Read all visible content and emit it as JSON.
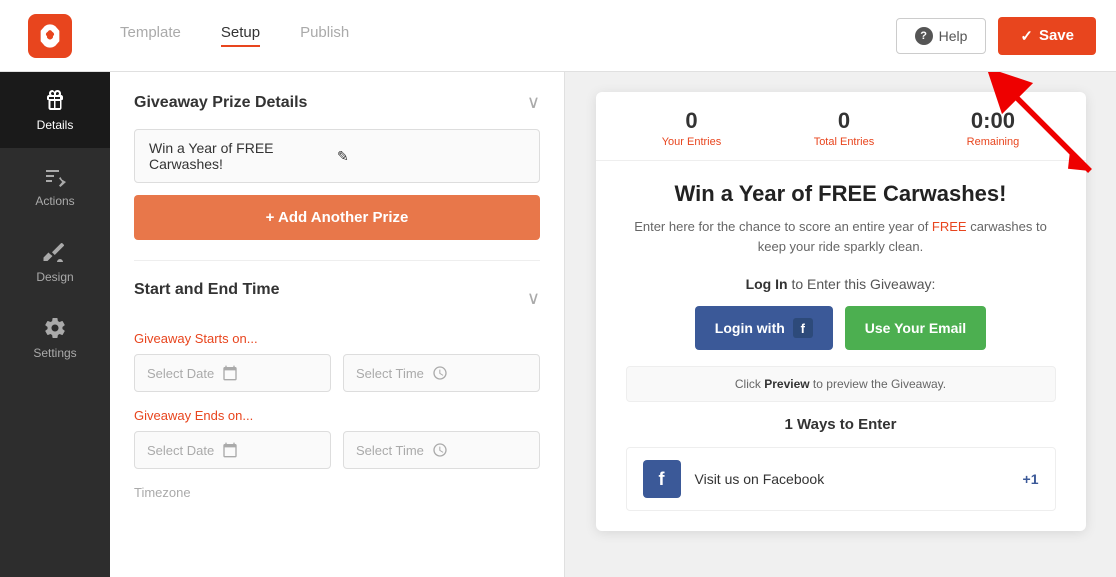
{
  "topNav": {
    "tabs": [
      {
        "id": "template",
        "label": "Template",
        "active": false
      },
      {
        "id": "setup",
        "label": "Setup",
        "active": true
      },
      {
        "id": "publish",
        "label": "Publish",
        "active": false
      }
    ],
    "helpLabel": "Help",
    "saveLabel": "Save"
  },
  "sidebar": {
    "items": [
      {
        "id": "details",
        "label": "Details",
        "active": true,
        "icon": "gift"
      },
      {
        "id": "actions",
        "label": "Actions",
        "active": false,
        "icon": "actions"
      },
      {
        "id": "design",
        "label": "Design",
        "active": false,
        "icon": "design"
      },
      {
        "id": "settings",
        "label": "Settings",
        "active": false,
        "icon": "settings"
      }
    ]
  },
  "leftPanel": {
    "prizeSectionTitle": "Giveaway Prize Details",
    "prizeValue": "Win a Year of FREE Carwashes!",
    "addPrizeLabel": "+ Add Another Prize",
    "dateSectionTitle": "Start and End Time",
    "startLabel": "Giveaway Starts on...",
    "startDatePlaceholder": "Select Date",
    "startTimePlaceholder": "Select Time",
    "endLabel": "Giveaway Ends on...",
    "endDatePlaceholder": "Select Date",
    "endTimePlaceholder": "Select Time",
    "timezoneLabel": "Timezone"
  },
  "preview": {
    "stats": [
      {
        "value": "0",
        "label": "Your Entries"
      },
      {
        "value": "0",
        "label": "Total Entries"
      },
      {
        "value": "0:00",
        "label": "Remaining"
      }
    ],
    "title": "Win a Year of FREE Carwashes!",
    "description": "Enter here for the chance to score an entire year of FREE carwashes to keep your ride sparkly clean.",
    "loginPrompt": "Log In to Enter this Giveaway:",
    "loginWithLabel": "Login with",
    "useEmailLabel": "Use Your Email",
    "previewHint": "Click Preview to preview the Giveaway.",
    "waysLabel": "1 Ways to Enter",
    "visitFbLabel": "Visit us on Facebook",
    "visitFbPoints": "+1"
  }
}
